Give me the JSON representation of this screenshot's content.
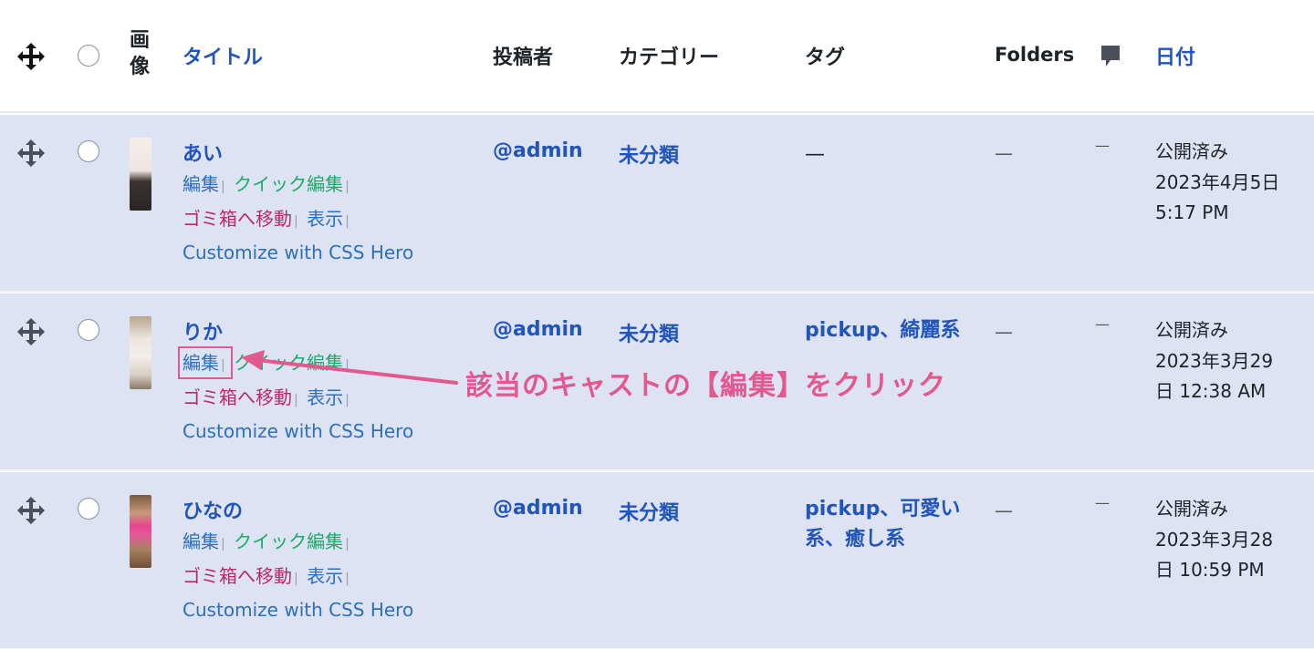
{
  "header": {
    "image_col": "画\n像",
    "title_col": "タイトル",
    "author_col": "投稿者",
    "category_col": "カテゴリー",
    "tags_col": "タグ",
    "folders_col": "Folders",
    "date_col": "日付"
  },
  "rows": [
    {
      "title": "あい",
      "actions": {
        "edit": "編集",
        "quick_edit": "クイック編集",
        "trash": "ゴミ箱へ移動",
        "view": "表示",
        "css": "Customize with CSS Hero",
        "separator": "|"
      },
      "author": "@admin",
      "category": "未分類",
      "tags": "—",
      "folders": "—",
      "comments": "—",
      "date_status": "公開済み",
      "date_line1": "2023年4月5日",
      "date_line2": "5:17 PM"
    },
    {
      "title": "りか",
      "actions": {
        "edit": "編集",
        "quick_edit": "クイック編集",
        "trash": "ゴミ箱へ移動",
        "view": "表示",
        "css": "Customize with CSS Hero",
        "separator": "|"
      },
      "author": "@admin",
      "category": "未分類",
      "tags": "pickup、綺麗系",
      "folders": "—",
      "comments": "—",
      "date_status": "公開済み",
      "date_line1": "2023年3月29",
      "date_line2": "日 12:38 AM"
    },
    {
      "title": "ひなの",
      "actions": {
        "edit": "編集",
        "quick_edit": "クイック編集",
        "trash": "ゴミ箱へ移動",
        "view": "表示",
        "css": "Customize with CSS Hero",
        "separator": "|"
      },
      "author": "@admin",
      "category": "未分類",
      "tags_line1": "pickup、可愛い",
      "tags_line2": "系、癒し系",
      "folders": "—",
      "comments": "—",
      "date_status": "公開済み",
      "date_line1": "2023年3月28",
      "date_line2": "日 10:59 PM"
    }
  ],
  "annotation": {
    "text": "該当のキャストの【編集】をクリック",
    "color": "#e2588f"
  },
  "colors": {
    "link": "#2255bb",
    "row_bg": "#dde3f3",
    "quick_edit": "#1fa86a",
    "trash": "#b8296b"
  },
  "icons": [
    "move-icon",
    "comment-bubble-icon"
  ]
}
